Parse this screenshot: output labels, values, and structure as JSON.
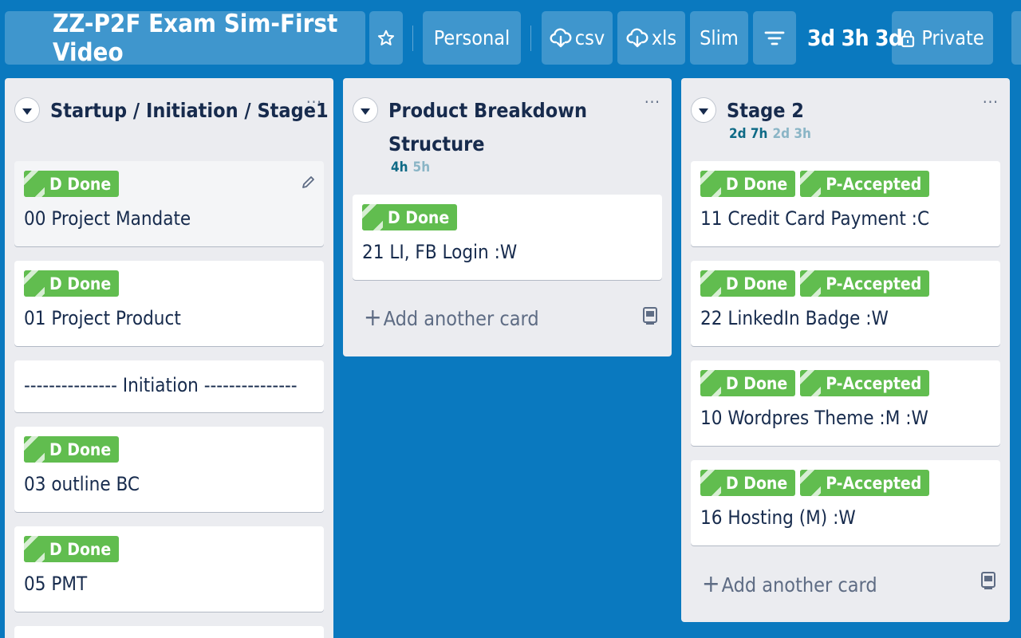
{
  "header": {
    "board_title": "ZZ-P2F Exam Sim-First Video",
    "star_icon": "star-icon",
    "personal_label": "Personal",
    "csv_label": "csv",
    "xls_label": "xls",
    "slim_label": "Slim",
    "filter_icon": "filter-icon",
    "counts": [
      "3d",
      "3h",
      "3d"
    ],
    "private_label": "Private"
  },
  "lists": [
    {
      "title": "Startup / Initiation / Stage1",
      "cards": [
        {
          "labels": [
            "D Done"
          ],
          "title": "00 Project Mandate"
        },
        {
          "labels": [
            "D Done"
          ],
          "title": "01 Project Product"
        },
        {
          "labels": [],
          "title": "--------------- Initiation ---------------"
        },
        {
          "labels": [
            "D Done"
          ],
          "title": "03 outline BC"
        },
        {
          "labels": [
            "D Done"
          ],
          "title": "05 PMT"
        }
      ]
    },
    {
      "title_line1": "Product Breakdown",
      "title_line2": "Structure",
      "estimate_spent": "4h",
      "estimate_total": "5h",
      "cards": [
        {
          "labels": [
            "D Done"
          ],
          "title": "21 LI, FB Login :W"
        }
      ],
      "add_card_label": "Add another card"
    },
    {
      "title": "Stage 2",
      "estimate_spent": "2d 7h",
      "estimate_total": "2d 3h",
      "cards": [
        {
          "labels": [
            "D Done",
            "P-Accepted"
          ],
          "title": "11 Credit Card Payment :C"
        },
        {
          "labels": [
            "D Done",
            "P-Accepted"
          ],
          "title": "22 LinkedIn Badge :W"
        },
        {
          "labels": [
            "D Done",
            "P-Accepted"
          ],
          "title": "10 Wordpres Theme :M :W"
        },
        {
          "labels": [
            "D Done",
            "P-Accepted"
          ],
          "title": "16 Hosting (M) :W"
        }
      ],
      "add_card_label": "Add another card"
    }
  ],
  "colors": {
    "board_background": "#0a79bf",
    "label_green": "#61bd4f",
    "list_background": "#ebecf0"
  }
}
